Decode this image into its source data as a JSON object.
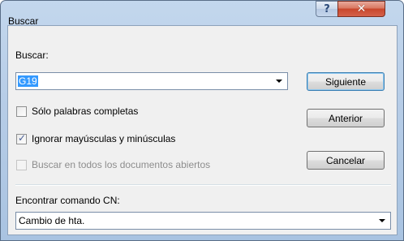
{
  "window": {
    "title": "Buscar",
    "help_glyph": "?",
    "close_glyph": "✕"
  },
  "search": {
    "label": "Buscar:",
    "value": "G19"
  },
  "options": {
    "whole_words": {
      "label": "Sólo palabras completas",
      "checked": false
    },
    "ignore_case": {
      "label": "Ignorar mayúsculas y minúsculas",
      "checked": true
    },
    "all_documents": {
      "label": "Buscar en todos los documentos abiertos",
      "checked": false,
      "disabled": true
    }
  },
  "buttons": {
    "next": "Siguiente",
    "previous": "Anterior",
    "cancel": "Cancelar"
  },
  "command": {
    "label": "Encontrar comando CN:",
    "value": "Cambio de hta."
  },
  "icons": {
    "help": "help-icon",
    "close": "close-icon",
    "dropdown": "chevron-down-icon",
    "check": "checkmark-icon"
  },
  "colors": {
    "selection": "#3399ff",
    "close_button": "#c8472c",
    "titlebar": "#b7cde7"
  }
}
